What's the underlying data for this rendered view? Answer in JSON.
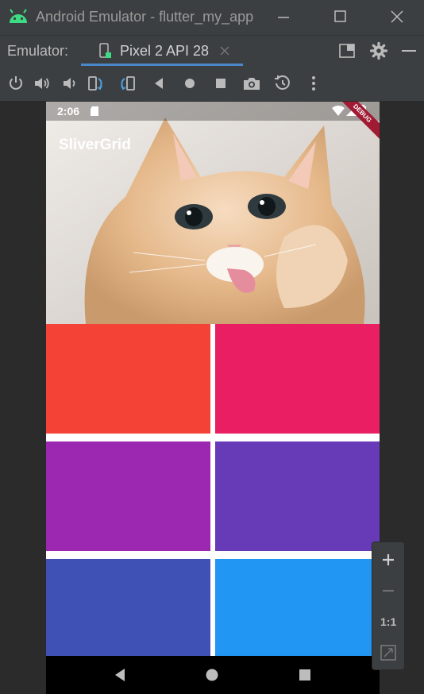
{
  "window": {
    "title": "Android Emulator - flutter_my_app",
    "accent": "#3ddc84"
  },
  "tabbar": {
    "label": "Emulator:",
    "device_tab": "Pixel 2 API 28"
  },
  "toolbar": {
    "icons": [
      "power-icon",
      "volume-up-icon",
      "volume-down-icon",
      "rotate-left-icon",
      "rotate-right-icon",
      "back-icon",
      "home-icon",
      "overview-icon",
      "screenshot-icon",
      "snapshot-icon",
      "more-icon"
    ]
  },
  "phone": {
    "status_time": "2:06",
    "app_title": "SliverGrid",
    "debug_banner": "DEBUG",
    "grid_colors": [
      "#f44336",
      "#e91e63",
      "#9c27b0",
      "#673ab7",
      "#3f51b5",
      "#2196f3"
    ]
  },
  "zoom_controls": {
    "plus": "+",
    "minus": "−",
    "actual_size": "1:1"
  }
}
